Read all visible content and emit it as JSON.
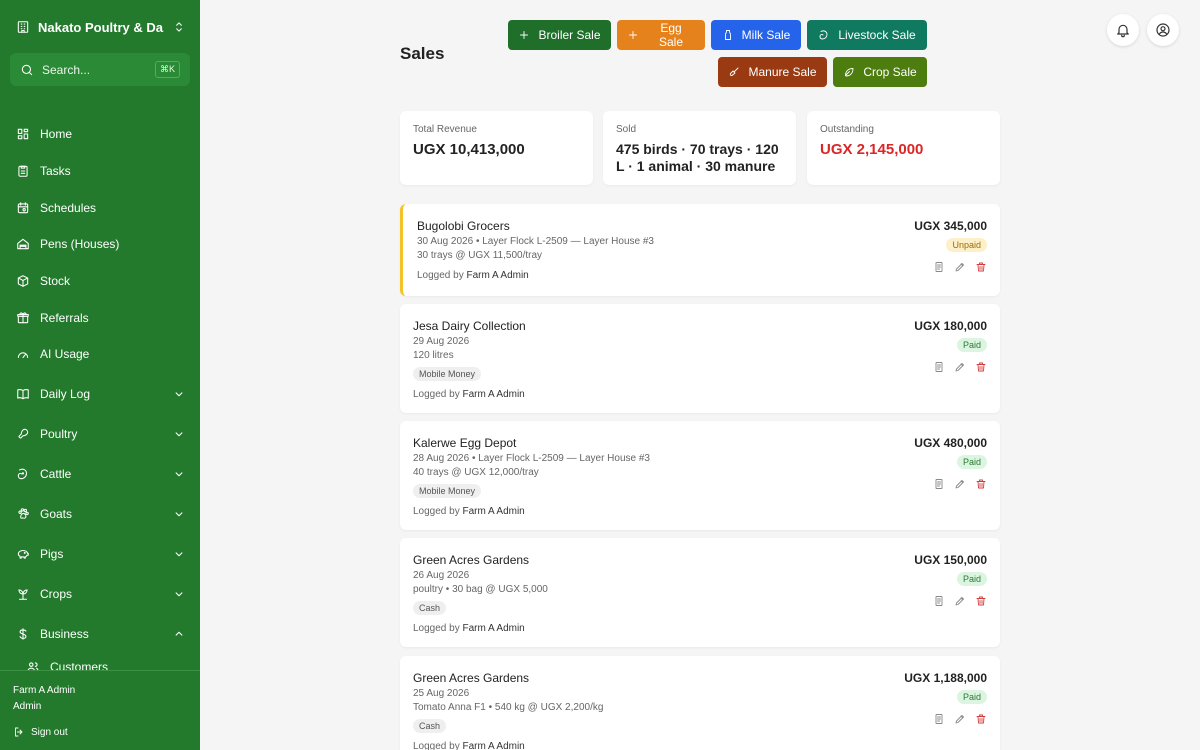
{
  "sidebar": {
    "farm_name": "Nakato Poultry & Da...",
    "search_placeholder": "Search...",
    "search_shortcut": "⌘K",
    "items": [
      {
        "label": "Home",
        "icon": "grid-icon"
      },
      {
        "label": "Tasks",
        "icon": "clipboard-icon"
      },
      {
        "label": "Schedules",
        "icon": "calendar-icon"
      },
      {
        "label": "Pens (Houses)",
        "icon": "house-icon"
      },
      {
        "label": "Stock",
        "icon": "box-icon"
      },
      {
        "label": "Referrals",
        "icon": "gift-icon"
      },
      {
        "label": "AI Usage",
        "icon": "gauge-icon"
      },
      {
        "label": "Daily Log",
        "icon": "book-icon",
        "expandable": true
      },
      {
        "label": "Poultry",
        "icon": "drumstick-icon",
        "expandable": true
      },
      {
        "label": "Cattle",
        "icon": "milk-icon",
        "expandable": true
      },
      {
        "label": "Goats",
        "icon": "paw-icon",
        "expandable": true
      },
      {
        "label": "Pigs",
        "icon": "piggy-icon",
        "expandable": true
      },
      {
        "label": "Crops",
        "icon": "sprout-icon",
        "expandable": true
      },
      {
        "label": "Business",
        "icon": "dollar-icon",
        "expandable": true,
        "expanded": true
      }
    ],
    "subitem": "Customers",
    "user_name": "Farm A Admin",
    "user_role": "Admin",
    "sign_out": "Sign out"
  },
  "header": {
    "title": "Sales",
    "buttons": {
      "broiler": "Broiler Sale",
      "egg": "Egg Sale",
      "milk": "Milk Sale",
      "livestock": "Livestock Sale",
      "manure": "Manure Sale",
      "crop": "Crop Sale"
    }
  },
  "stats": {
    "revenue_label": "Total Revenue",
    "revenue_value": "UGX 10,413,000",
    "sold_label": "Sold",
    "sold_value": "475 birds · 70 trays · 120 L · 1 animal · 30 manure",
    "outstanding_label": "Outstanding",
    "outstanding_value": "UGX 2,145,000"
  },
  "sales": [
    {
      "customer": "Bugolobi Grocers",
      "meta": "30 Aug 2026 • Layer Flock L-2509 — Layer House #3",
      "detail": "30 trays @ UGX 11,500/tray",
      "method": "",
      "logged_prefix": "Logged by",
      "logged_by": "Farm A Admin",
      "amount": "UGX 345,000",
      "status": "Unpaid"
    },
    {
      "customer": "Jesa Dairy Collection",
      "meta": "29 Aug 2026",
      "detail": "120 litres",
      "method": "Mobile Money",
      "logged_prefix": "Logged by",
      "logged_by": "Farm A Admin",
      "amount": "UGX 180,000",
      "status": "Paid"
    },
    {
      "customer": "Kalerwe Egg Depot",
      "meta": "28 Aug 2026 • Layer Flock L-2509 — Layer House #3",
      "detail": "40 trays @ UGX 12,000/tray",
      "method": "Mobile Money",
      "logged_prefix": "Logged by",
      "logged_by": "Farm A Admin",
      "amount": "UGX 480,000",
      "status": "Paid"
    },
    {
      "customer": "Green Acres Gardens",
      "meta": "26 Aug 2026",
      "detail": "poultry • 30 bag @ UGX 5,000",
      "method": "Cash",
      "logged_prefix": "Logged by",
      "logged_by": "Farm A Admin",
      "amount": "UGX 150,000",
      "status": "Paid"
    },
    {
      "customer": "Green Acres Gardens",
      "meta": "25 Aug 2026",
      "detail": "Tomato Anna F1 • 540 kg @ UGX 2,200/kg",
      "method": "Cash",
      "logged_prefix": "Logged by",
      "logged_by": "Farm A Admin",
      "amount": "UGX 1,188,000",
      "status": "Paid"
    }
  ],
  "colors": {
    "sidebar": "#237a2c",
    "broiler": "#1f6e2a",
    "egg": "#e6821c",
    "milk": "#2563eb",
    "livestock": "#0f7a5f",
    "manure": "#9a3a12",
    "crop": "#4d7c0f",
    "outstanding": "#dc2626",
    "unpaid_border": "#f2c228"
  }
}
